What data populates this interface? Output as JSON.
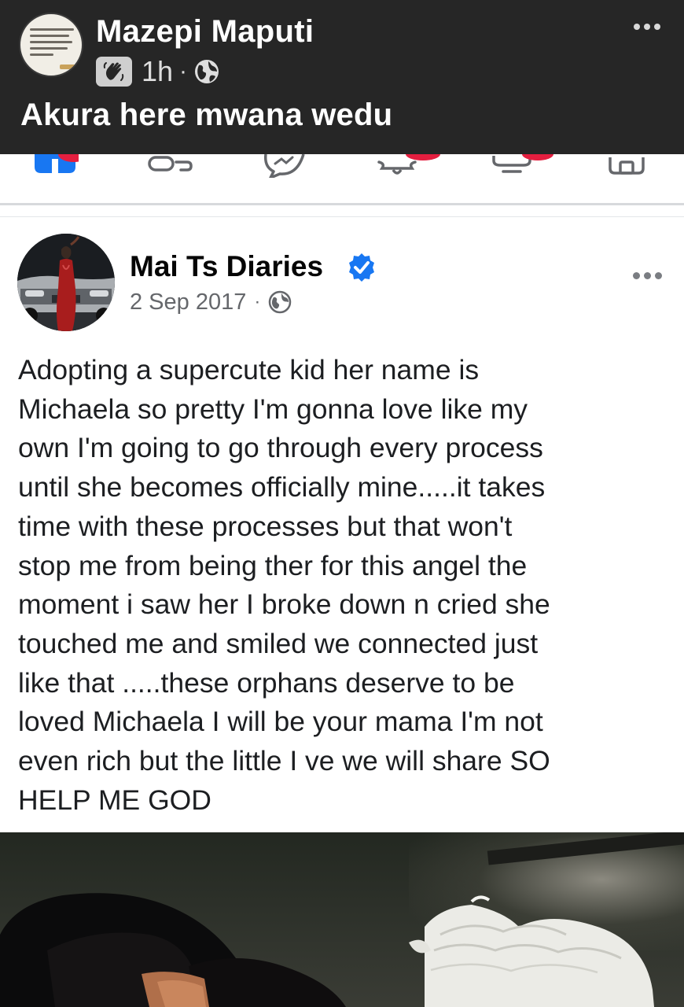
{
  "outer_post": {
    "author": "Mazepi Maputi",
    "time": "1h",
    "separator": "·",
    "audience_icon": "globe-icon",
    "badge_icon": "wave-icon",
    "caption": "Akura here mwana wedu",
    "more_icon": "more-dots-icon"
  },
  "nav_strip_icons": [
    "home-icon",
    "friends-icon",
    "messenger-icon",
    "notifications-icon",
    "watch-icon",
    "marketplace-icon"
  ],
  "shared_post": {
    "author": "Mai Ts Diaries",
    "verified": true,
    "date": "2 Sep 2017",
    "separator": "·",
    "audience_icon": "globe-icon",
    "more_icon": "more-dots-icon",
    "text_lines": [
      "Adopting a supercute kid her name is",
      "Michaela so pretty I'm gonna love like my",
      "own I'm going to go through every process",
      "until she becomes officially mine.....it takes",
      "time with these processes but that won't",
      "stop me from being ther for this angel the",
      "moment i saw her I broke down n cried she",
      "touched me and smiled we connected just",
      "like that .....these orphans deserve to be",
      "loved Michaela I will be your mama I'm not",
      "even rich but the little I ve we will share SO",
      "HELP ME GOD"
    ]
  },
  "colors": {
    "header_bg": "#262626",
    "facebook_blue": "#1877f2",
    "notification_red": "#e41e3f",
    "meta_gray": "#65676b",
    "text": "#1c1e21"
  }
}
